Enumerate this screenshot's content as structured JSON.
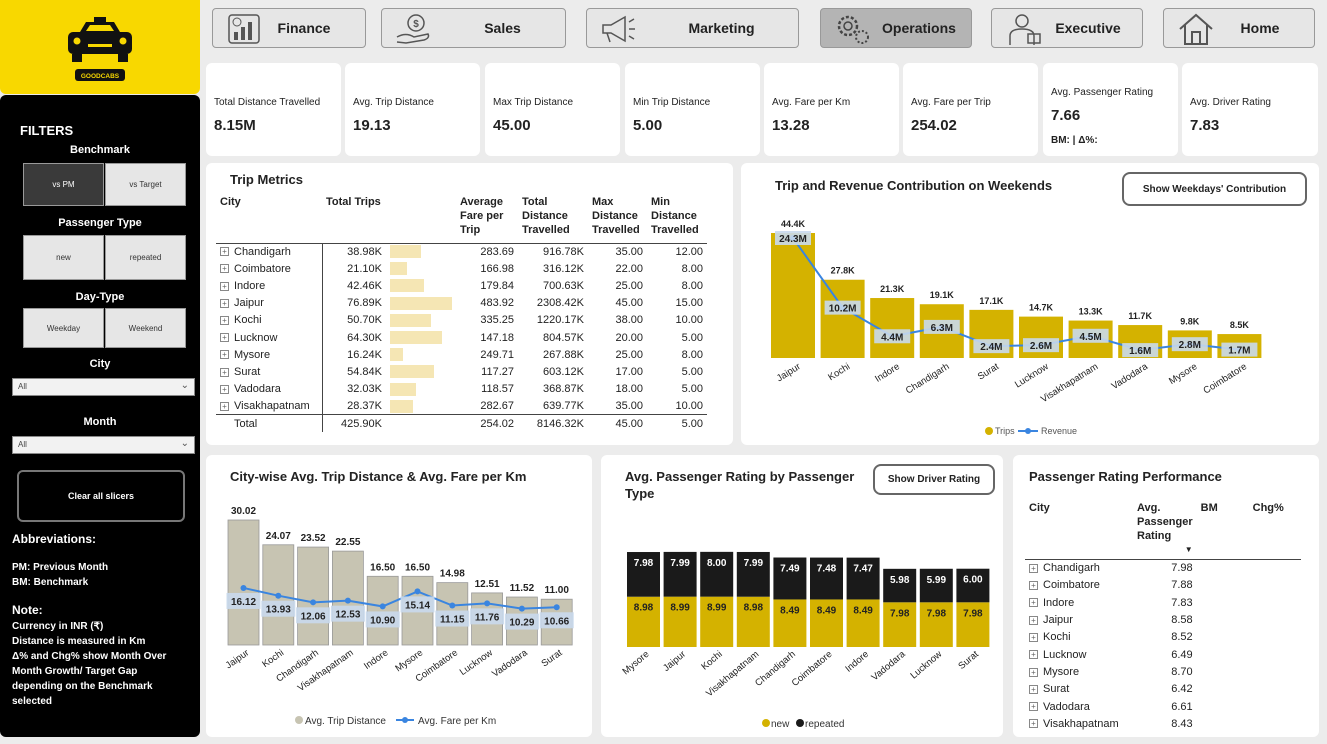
{
  "brand": {
    "name": "GOODCABS"
  },
  "sidebar": {
    "filters_title": "FILTERS",
    "benchmark": {
      "label": "Benchmark",
      "options": [
        "vs PM",
        "vs Target"
      ],
      "selected": "vs PM"
    },
    "passenger_type": {
      "label": "Passenger Type",
      "options": [
        "new",
        "repeated"
      ]
    },
    "day_type": {
      "label": "Day-Type",
      "options": [
        "Weekday",
        "Weekend"
      ]
    },
    "city": {
      "label": "City",
      "value": "All"
    },
    "month": {
      "label": "Month",
      "value": "All"
    },
    "clear_label": "Clear all slicers",
    "abbrev_title": "Abbreviations:",
    "abbrev": [
      "PM: Previous Month",
      "BM: Benchmark"
    ],
    "note_title": "Note:",
    "notes": [
      "Currency in INR (₹)",
      "Distance is measured in Km",
      "Δ% and Chg% show Month Over",
      "Month Growth/ Target Gap",
      "depending on the Benchmark",
      "selected"
    ]
  },
  "nav": [
    "Finance",
    "Sales",
    "Marketing",
    "Operations",
    "Executive",
    "Home"
  ],
  "nav_selected": "Operations",
  "kpis": [
    {
      "title": "Total Distance Travelled",
      "value": "8.15M"
    },
    {
      "title": "Avg. Trip Distance",
      "value": "19.13"
    },
    {
      "title": "Max Trip Distance",
      "value": "45.00"
    },
    {
      "title": "Min Trip Distance",
      "value": "5.00"
    },
    {
      "title": "Avg. Fare per Km",
      "value": "13.28"
    },
    {
      "title": "Avg. Fare per Trip",
      "value": "254.02"
    },
    {
      "title": "Avg. Passenger Rating",
      "value": "7.66",
      "extra": "BM: | Δ%:"
    },
    {
      "title": "Avg. Driver Rating",
      "value": "7.83"
    }
  ],
  "trip_metrics": {
    "title": "Trip Metrics",
    "headers": [
      "City",
      "Total Trips",
      "Average Fare per Trip",
      "Total Distance Travelled",
      "Max Distance Travelled",
      "Min Distance Travelled"
    ],
    "rows": [
      {
        "city": "Chandigarh",
        "trips": "38.98K",
        "trips_num": 38.98,
        "fare": "283.69",
        "dist": "916.78K",
        "max": "35.00",
        "min": "12.00"
      },
      {
        "city": "Coimbatore",
        "trips": "21.10K",
        "trips_num": 21.1,
        "fare": "166.98",
        "dist": "316.12K",
        "max": "22.00",
        "min": "8.00"
      },
      {
        "city": "Indore",
        "trips": "42.46K",
        "trips_num": 42.46,
        "fare": "179.84",
        "dist": "700.63K",
        "max": "25.00",
        "min": "8.00"
      },
      {
        "city": "Jaipur",
        "trips": "76.89K",
        "trips_num": 76.89,
        "fare": "483.92",
        "dist": "2308.42K",
        "max": "45.00",
        "min": "15.00"
      },
      {
        "city": "Kochi",
        "trips": "50.70K",
        "trips_num": 50.7,
        "fare": "335.25",
        "dist": "1220.17K",
        "max": "38.00",
        "min": "10.00"
      },
      {
        "city": "Lucknow",
        "trips": "64.30K",
        "trips_num": 64.3,
        "fare": "147.18",
        "dist": "804.57K",
        "max": "20.00",
        "min": "5.00"
      },
      {
        "city": "Mysore",
        "trips": "16.24K",
        "trips_num": 16.24,
        "fare": "249.71",
        "dist": "267.88K",
        "max": "25.00",
        "min": "8.00"
      },
      {
        "city": "Surat",
        "trips": "54.84K",
        "trips_num": 54.84,
        "fare": "117.27",
        "dist": "603.12K",
        "max": "17.00",
        "min": "5.00"
      },
      {
        "city": "Vadodara",
        "trips": "32.03K",
        "trips_num": 32.03,
        "fare": "118.57",
        "dist": "368.87K",
        "max": "18.00",
        "min": "5.00"
      },
      {
        "city": "Visakhapatnam",
        "trips": "28.37K",
        "trips_num": 28.37,
        "fare": "282.67",
        "dist": "639.77K",
        "max": "35.00",
        "min": "10.00"
      }
    ],
    "total": {
      "city": "Total",
      "trips": "425.90K",
      "fare": "254.02",
      "dist": "8146.32K",
      "max": "45.00",
      "min": "5.00"
    }
  },
  "weekend_chart": {
    "title": "Trip and Revenue Contribution on Weekends",
    "button": "Show Weekdays' Contribution",
    "legend": [
      "Trips",
      "Revenue"
    ]
  },
  "distance_chart": {
    "title": "City-wise Avg. Trip Distance & Avg. Fare per Km",
    "legend": [
      "Avg. Trip Distance",
      "Avg. Fare per Km"
    ]
  },
  "rating_chart": {
    "title_line1": "Avg. Passenger Rating by Passenger",
    "title_line2": "Type",
    "button": "Show Driver Rating",
    "legend": [
      "new",
      "repeated"
    ]
  },
  "passenger_rating": {
    "title": "Passenger Rating Performance",
    "headers": [
      "City",
      "Avg. Passenger Rating",
      "BM",
      "Chg%"
    ],
    "rows": [
      {
        "city": "Chandigarh",
        "rating": "7.98"
      },
      {
        "city": "Coimbatore",
        "rating": "7.88"
      },
      {
        "city": "Indore",
        "rating": "7.83"
      },
      {
        "city": "Jaipur",
        "rating": "8.58"
      },
      {
        "city": "Kochi",
        "rating": "8.52"
      },
      {
        "city": "Lucknow",
        "rating": "6.49"
      },
      {
        "city": "Mysore",
        "rating": "8.70"
      },
      {
        "city": "Surat",
        "rating": "6.42"
      },
      {
        "city": "Vadodara",
        "rating": "6.61"
      },
      {
        "city": "Visakhapatnam",
        "rating": "8.43"
      }
    ]
  },
  "chart_data": [
    {
      "type": "bar",
      "title": "Trip and Revenue Contribution on Weekends",
      "categories": [
        "Jaipur",
        "Kochi",
        "Indore",
        "Chandigarh",
        "Surat",
        "Lucknow",
        "Visakhapatnam",
        "Vadodara",
        "Mysore",
        "Coimbatore"
      ],
      "series": [
        {
          "name": "Trips",
          "type": "bar",
          "values": [
            44.4,
            27.8,
            21.3,
            19.1,
            17.1,
            14.7,
            13.3,
            11.7,
            9.8,
            8.5
          ],
          "labels": [
            "44.4K",
            "27.8K",
            "21.3K",
            "19.1K",
            "17.1K",
            "14.7K",
            "13.3K",
            "11.7K",
            "9.8K",
            "8.5K"
          ]
        },
        {
          "name": "Revenue",
          "type": "line",
          "values": [
            24.3,
            10.2,
            4.4,
            6.3,
            2.4,
            2.6,
            4.5,
            1.6,
            2.8,
            1.7
          ],
          "labels": [
            "24.3M",
            "10.2M",
            "4.4M",
            "6.3M",
            "2.4M",
            "2.6M",
            "4.5M",
            "1.6M",
            "2.8M",
            "1.7M"
          ]
        }
      ],
      "legend": "bottom",
      "colors": {
        "bar": "#d4b200",
        "line": "#3a85e0"
      }
    },
    {
      "type": "bar",
      "title": "City-wise Avg. Trip Distance & Avg. Fare per Km",
      "categories": [
        "Jaipur",
        "Kochi",
        "Chandigarh",
        "Visakhapatnam",
        "Indore",
        "Mysore",
        "Coimbatore",
        "Lucknow",
        "Vadodara",
        "Surat"
      ],
      "series": [
        {
          "name": "Avg. Trip Distance",
          "type": "bar",
          "values": [
            30.02,
            24.07,
            23.52,
            22.55,
            16.5,
            16.5,
            14.98,
            12.51,
            11.52,
            11.0
          ]
        },
        {
          "name": "Avg. Fare per Km",
          "type": "line",
          "values": [
            16.12,
            13.93,
            12.06,
            12.53,
            10.9,
            15.14,
            11.15,
            11.76,
            10.29,
            10.66
          ]
        }
      ],
      "legend": "bottom",
      "colors": {
        "bar": "#c7c4b2",
        "line": "#3a85e0"
      }
    },
    {
      "type": "bar",
      "stacked": true,
      "title": "Avg. Passenger Rating by Passenger Type",
      "categories": [
        "Mysore",
        "Jaipur",
        "Kochi",
        "Visakhapatnam",
        "Chandigarh",
        "Coimbatore",
        "Indore",
        "Vadodara",
        "Lucknow",
        "Surat"
      ],
      "series": [
        {
          "name": "new",
          "values": [
            8.98,
            8.99,
            8.99,
            8.98,
            8.49,
            8.49,
            8.49,
            7.98,
            7.98,
            7.98
          ]
        },
        {
          "name": "repeated",
          "values": [
            7.98,
            7.99,
            8.0,
            7.99,
            7.49,
            7.48,
            7.47,
            5.98,
            5.99,
            6.0
          ]
        }
      ],
      "legend": "bottom",
      "colors": {
        "new": "#d4b200",
        "repeated": "#1a1a1a"
      }
    }
  ]
}
